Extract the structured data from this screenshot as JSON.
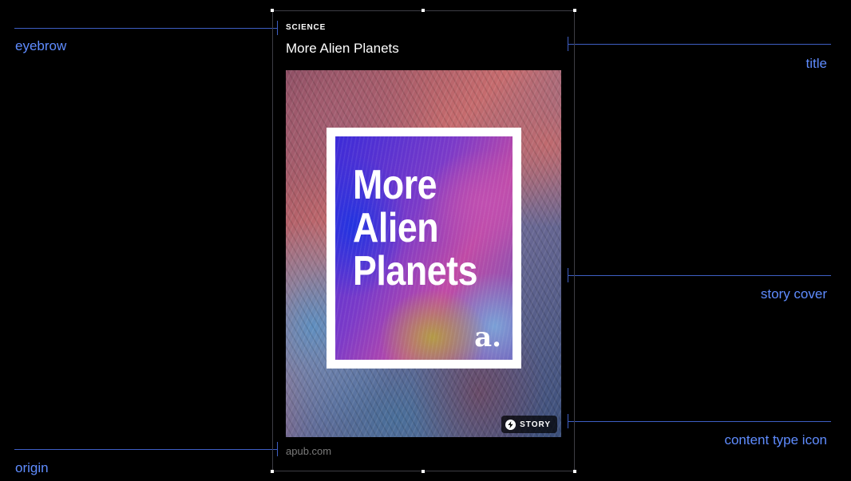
{
  "annotations": {
    "eyebrow": "eyebrow",
    "title": "title",
    "story_cover": "story cover",
    "content_type_icon": "content type icon",
    "origin": "origin"
  },
  "card": {
    "eyebrow": "SCIENCE",
    "title": "More Alien Planets",
    "origin": "apub.com",
    "cover": {
      "headline": [
        "More",
        "Alien",
        "Planets"
      ],
      "logo": "a.",
      "badge_label": "STORY",
      "badge_icon": "bolt-icon"
    }
  },
  "colors": {
    "annotation": "#5f8cff",
    "annotation_line": "#3e5fc4",
    "background": "#000000"
  }
}
